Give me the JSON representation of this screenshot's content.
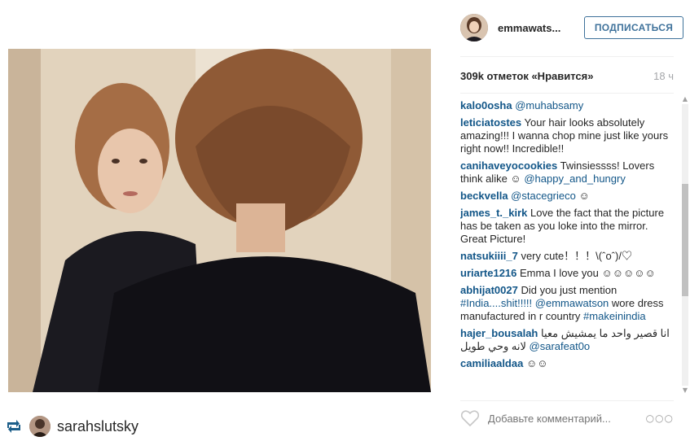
{
  "post": {
    "repost_user": "sarahslutsky",
    "icons": {
      "repost": "repost-icon",
      "heart": "heart-icon",
      "more": "more-options-icon"
    }
  },
  "header": {
    "username": "emmawats...",
    "follow_label": "ПОДПИСАТЬСЯ"
  },
  "stats": {
    "likes": "309k отметок «Нравится»",
    "time": "18 ч"
  },
  "comments": [
    {
      "user": "kalo0osha",
      "text": "",
      "mention": "@muhabsamy"
    },
    {
      "user": "leticiatostes",
      "text": "Your hair looks absolutely amazing!!! I wanna chop mine just like yours right now!! Incredible!!"
    },
    {
      "user": "canihaveyocookies",
      "text": "Twinsiessss! Lovers think alike ☺",
      "mention": "@happy_and_hungry"
    },
    {
      "user": "beckvella",
      "text": "",
      "mention": "@stacegrieco",
      "suffix": " ☺"
    },
    {
      "user": "james_t._kirk",
      "text": "Love the fact that the picture has be taken as you loke into the mirror. Great Picture!"
    },
    {
      "user": "natsukiiii_7",
      "text": "very cute！！！\\(ˆoˆ)/♡"
    },
    {
      "user": "uriarte1216",
      "text": "Emma I love you ☺☺☺☺☺"
    },
    {
      "user": "abhijat0027",
      "text": "Did you just mention",
      "tag1": "#India....shit!!!!!",
      "mention": "@emmawatson",
      "text2": "wore dress manufactured in r country",
      "tag2": "#makeinindia"
    },
    {
      "user": "hajer_bousalah",
      "text": "انا قصير واحد ما يمشيش معيا لانه وحي طويل",
      "mention": "@sarafeat0o"
    },
    {
      "user": "camiliaaldaa",
      "text": "☺☺"
    }
  ],
  "input": {
    "placeholder": "Добавьте комментарий..."
  },
  "colors": {
    "link": "#125688",
    "follow_border": "#3f729b",
    "muted": "#a5a7aa"
  }
}
